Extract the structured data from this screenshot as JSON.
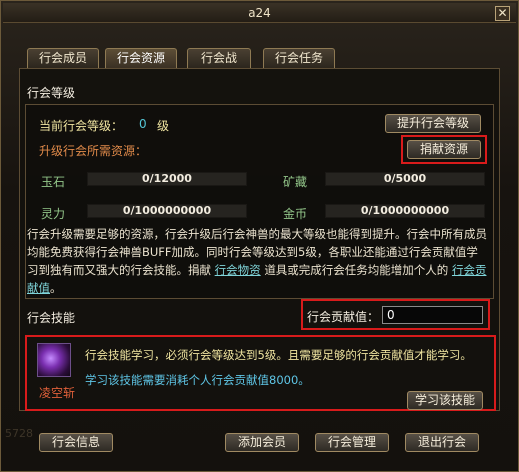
{
  "window": {
    "title": "a24"
  },
  "tabs": [
    "行会成员",
    "行会资源",
    "行会战",
    "行会任务"
  ],
  "level_section": {
    "title": "行会等级",
    "current_level_label": "当前行会等级：",
    "current_level_value": "0",
    "current_level_unit": "级",
    "upgrade_button": "提升行会等级",
    "required_resources_label": "升级行会所需资源：",
    "donate_button": "捐献资源",
    "resources": [
      {
        "name": "玉石",
        "value": "0/12000"
      },
      {
        "name": "矿藏",
        "value": "0/5000"
      },
      {
        "name": "灵力",
        "value": "0/1000000000"
      },
      {
        "name": "金币",
        "value": "0/1000000000"
      }
    ],
    "description": {
      "part1": "行会升级需要足够的资源，行会升级后行会神兽的最大等级也能得到提升。行会中所有成员均能免费获得行会神兽BUFF加成。同时行会等级达到5级，各职业还能通过行会贡献值学习到独有而又强大的行会技能。捐献",
      "link1": "行会物资",
      "part2": "道具或完成行会任务均能增加个人的",
      "link2": "行会贡献值",
      "part3": "。"
    }
  },
  "skill_section": {
    "title": "行会技能",
    "contribution_label": "行会贡献值：",
    "contribution_value": "0",
    "skill_name": "凌空斩",
    "line1": "行会技能学习，必须行会等级达到5级。且需要足够的行会贡献值才能学习。",
    "line2": "学习该技能需要消耗个人行会贡献值8000。",
    "learn_button": "学习该技能"
  },
  "bottom_buttons": [
    "行会信息",
    "添加会员",
    "行会管理",
    "退出行会"
  ],
  "background_digits": "5728"
}
